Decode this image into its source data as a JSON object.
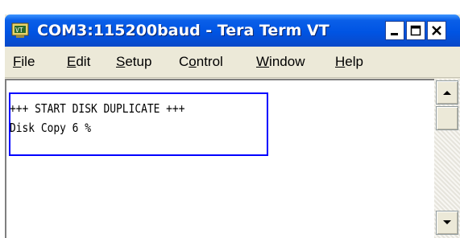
{
  "window": {
    "title": "COM3:115200baud - Tera Term VT",
    "icon": "teraterm-app-icon",
    "controls": {
      "minimize_icon": "minimize-icon",
      "maximize_icon": "maximize-icon",
      "close_icon": "close-icon"
    }
  },
  "menu": {
    "items": [
      {
        "label": "File",
        "mnemonic": "F",
        "rest": "ile"
      },
      {
        "label": "Edit",
        "mnemonic": "E",
        "rest": "dit"
      },
      {
        "label": "Setup",
        "mnemonic": "S",
        "rest": "etup"
      },
      {
        "label": "Control",
        "pre": "C",
        "mnemonic": "o",
        "rest": "ntrol"
      },
      {
        "label": "Window",
        "mnemonic": "W",
        "rest": "indow"
      },
      {
        "label": "Help",
        "mnemonic": "H",
        "rest": "elp"
      }
    ]
  },
  "terminal": {
    "lines": [
      "+++ START DISK DUPLICATE +++",
      "Disk Copy 6 %"
    ],
    "highlight_color": "#0000ff"
  },
  "scrollbar": {
    "up_icon": "arrow-up-icon",
    "down_icon": "arrow-down-icon"
  }
}
